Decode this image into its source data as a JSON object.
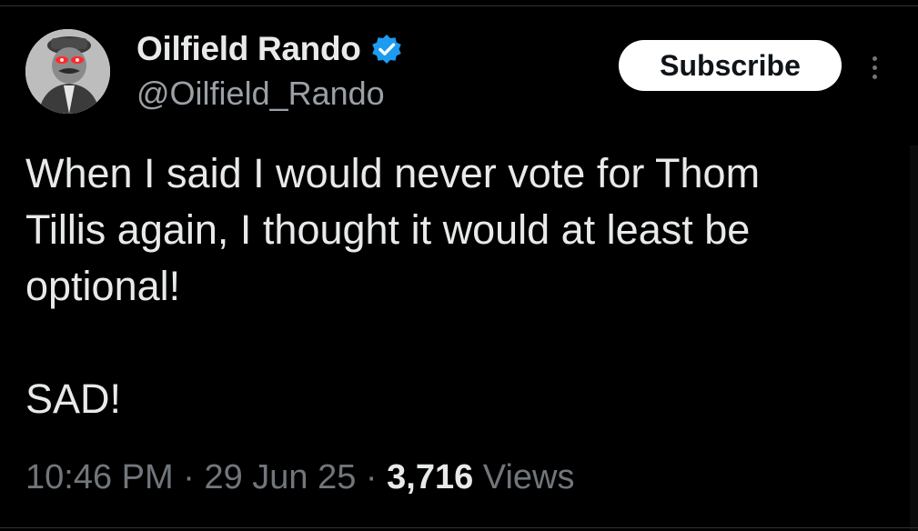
{
  "author": {
    "display_name": "Oilfield Rando",
    "handle": "@Oilfield_Rando",
    "verified_icon": "verified-badge-icon",
    "avatar_icon": "avatar"
  },
  "actions": {
    "subscribe_label": "Subscribe",
    "more_icon": "more-options-icon"
  },
  "tweet": {
    "text": "When I said I would never vote for Thom\nTillis again, I thought it would at least be\noptional!\n\nSAD!",
    "time": "10:46 PM",
    "separator": "·",
    "date": "29 Jun 25",
    "views_count": "3,716",
    "views_label": "Views"
  },
  "colors": {
    "background": "#000000",
    "text_primary": "#e7e9ea",
    "text_secondary": "#71767b",
    "verified_blue": "#1d9bf0",
    "subscribe_bg": "#ffffff"
  }
}
